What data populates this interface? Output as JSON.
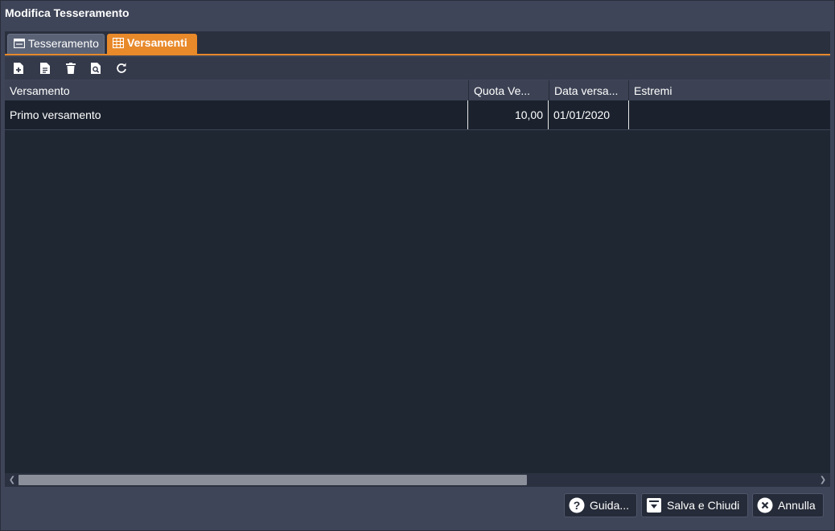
{
  "window": {
    "title": "Modifica Tesseramento"
  },
  "tabs": [
    {
      "label": "Tesseramento",
      "icon": "form-icon",
      "active": false
    },
    {
      "label": "Versamenti",
      "icon": "table-icon",
      "active": true
    }
  ],
  "toolbar": {
    "buttons": [
      {
        "name": "new-record",
        "icon": "file-plus-icon"
      },
      {
        "name": "edit-record",
        "icon": "file-text-icon"
      },
      {
        "name": "delete-record",
        "icon": "trash-icon"
      },
      {
        "name": "view-record",
        "icon": "file-search-icon"
      },
      {
        "name": "refresh",
        "icon": "refresh-icon"
      }
    ]
  },
  "grid": {
    "columns": [
      "Versamento",
      "Quota Ve...",
      "Data versa...",
      "Estremi"
    ],
    "rows": [
      {
        "versamento": "Primo versamento",
        "quota": "10,00",
        "data": "01/01/2020",
        "estremi": ""
      }
    ]
  },
  "footer": {
    "help_label": "Guida...",
    "save_label": "Salva e Chiudi",
    "cancel_label": "Annulla"
  },
  "colors": {
    "accent": "#e8892a",
    "background": "#3f4558",
    "grid_background": "#1f2733"
  }
}
